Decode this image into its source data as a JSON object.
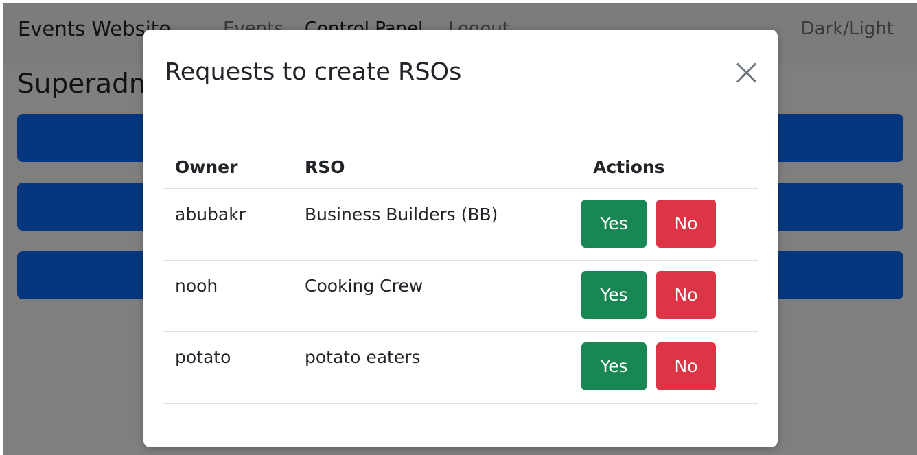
{
  "navbar": {
    "brand": "Events Website",
    "links": [
      "Events",
      "Control Panel",
      "Logout"
    ],
    "theme_toggle": "Dark/Light"
  },
  "page": {
    "title": "Superadmin"
  },
  "modal": {
    "title": "Requests to create RSOs",
    "close_icon": "close-x-icon",
    "columns": [
      "Owner",
      "RSO",
      "Actions"
    ],
    "rows": [
      {
        "owner": "abubakr",
        "rso": "Business Builders (BB)",
        "yes_label": "Yes",
        "no_label": "No"
      },
      {
        "owner": "nooh",
        "rso": "Cooking Crew",
        "yes_label": "Yes",
        "no_label": "No"
      },
      {
        "owner": "potato",
        "rso": "potato eaters",
        "yes_label": "Yes",
        "no_label": "No"
      }
    ]
  },
  "colors": {
    "primary": "#0d6efd",
    "success": "#198754",
    "danger": "#dc3545",
    "backdrop": "rgba(0,0,0,0.5)"
  }
}
